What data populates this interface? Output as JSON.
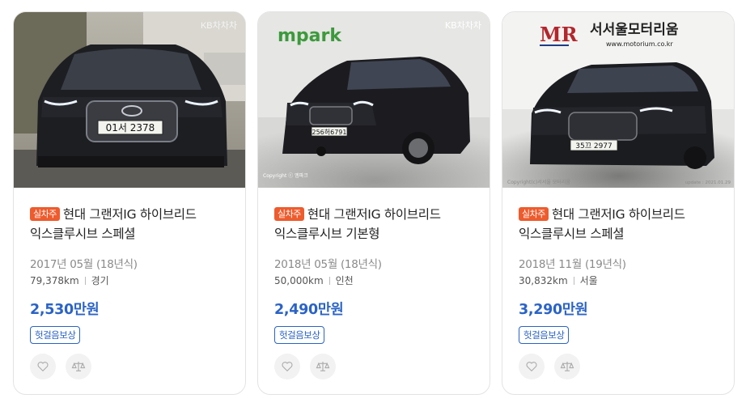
{
  "cards": [
    {
      "badge": "실차주",
      "title_line1": "현대 그랜저IG 하이브리드",
      "title_line2": "익스클루시브 스페셜",
      "year": "2017년 05월 (18년식)",
      "mileage": "79,378km",
      "region": "경기",
      "price": "2,530만원",
      "tag": "헛걸음보상",
      "watermark": "KB차차차",
      "plate": "01서 2378"
    },
    {
      "badge": "실차주",
      "title_line1": "현대 그랜저IG 하이브리드",
      "title_line2": "익스클루시브 기본형",
      "year": "2018년 05월 (18년식)",
      "mileage": "50,000km",
      "region": "인천",
      "price": "2,490만원",
      "tag": "헛걸음보상",
      "watermark": "KB차차차",
      "brand": "mpark",
      "plate": "256허6791",
      "copyright": "Copyright ⓒ 엠파크"
    },
    {
      "badge": "실차주",
      "title_line1": "현대 그랜저IG 하이브리드",
      "title_line2": "익스클루시브 스페셜",
      "year": "2018년 11월 (19년식)",
      "mileage": "30,832km",
      "region": "서울",
      "price": "3,290만원",
      "tag": "헛걸음보상",
      "dealer_name": "서서울모터리움",
      "dealer_url": "www.motorium.co.kr",
      "dealer_logo": "MR",
      "plate": "35끄 2977",
      "copyright": "Copyright(c)서서울 모터리움",
      "update": "update : 2021.01.29"
    }
  ],
  "icons": {
    "wishlist": "heart-icon",
    "compare": "scale-icon"
  },
  "colors": {
    "price": "#2b63c6",
    "badge": "#ee5b2d"
  }
}
